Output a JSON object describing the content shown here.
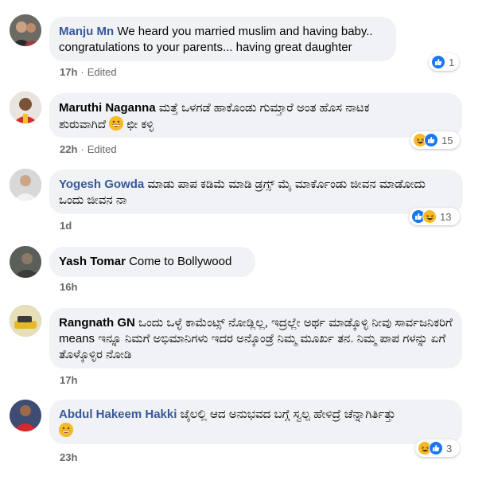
{
  "comments": [
    {
      "author": "Manju Mn",
      "text": "We heard you married muslim and having baby.. congratulations to your parents... having great daughter",
      "time": "17h",
      "edited": "Edited",
      "reaction_count": "1",
      "reactions": [
        "like"
      ]
    },
    {
      "author": "Maruthi Naganna",
      "text_line1": "ಮತ್ತೆ ಒಳಗಡೆ ಹಾಕೊಂಡು ಗುಮ್ತಾರೆ ಅಂತ ಹೊಸ ನಾಟಕ",
      "text_line2_a": "ಶುರುವಾಗಿದೆ",
      "text_line2_b": "ಛೀ ಕಳ್ಳಿ",
      "time": "22h",
      "edited": "Edited",
      "reaction_count": "15",
      "reactions": [
        "haha",
        "like"
      ]
    },
    {
      "author": "Yogesh Gowda",
      "text": "ಮಾಡು ಪಾಪ ಕಡಿಮೆ ಮಾಡಿ ಡ್ರಗ್ಸ್ ಮೈ ಮಾರ್ಕೊಂಡು ಜೀವನ ಮಾಡೋದು ಒಂದು ಜೀವನ ನಾ",
      "time": "1d",
      "reaction_count": "13",
      "reactions": [
        "like",
        "haha"
      ]
    },
    {
      "author": "Yash Tomar",
      "text": "Come to Bollywood",
      "time": "16h"
    },
    {
      "author": "Rangnath GN",
      "text": "ಒಂದು ಒಳ್ಳೆ ಕಾಮೆಂಟ್ಸ್ ನೋಡ್ಲಿಲ್ಲ, ಇದ್ರಲ್ಲೇ ಅರ್ಥ ಮಾಡ್ಕೊಳ್ಳಿ ನೀವು ಸಾರ್ವಜನಿಕರಿಗೆ means ಇನ್ನೂ ನಿಮಗೆ ಅಭಿಮಾನಿಗಳು ಇದರ ಅನ್ಕೊಂಡ್ರೆ ನಿಮ್ಮ ಮೂರ್ಖ ತನ. ನಿಮ್ಮ ಪಾಪ ಗಳನ್ನು ಏಗೆ ತೊಳ್ಕೊಳ್ಳಿರ ನೋಡಿ",
      "time": "17h"
    },
    {
      "author": "Abdul Hakeem Hakki",
      "text": "ಜೈಲಲ್ಲಿ ಆದ ಅನುಭವದ ಬಗ್ಗೆ ಸ್ವಲ್ಪ ಹೇಳಿದ್ರೆ ಚೆನ್ನಾಗಿರ್ತಿತ್ತು",
      "time": "23h",
      "reaction_count": "3",
      "reactions": [
        "haha",
        "like"
      ]
    }
  ],
  "colors": {
    "bubble": "#f0f2f5",
    "meta": "#65676b",
    "link": "#385898",
    "like": "#1877f2",
    "haha": "#f7b928"
  }
}
